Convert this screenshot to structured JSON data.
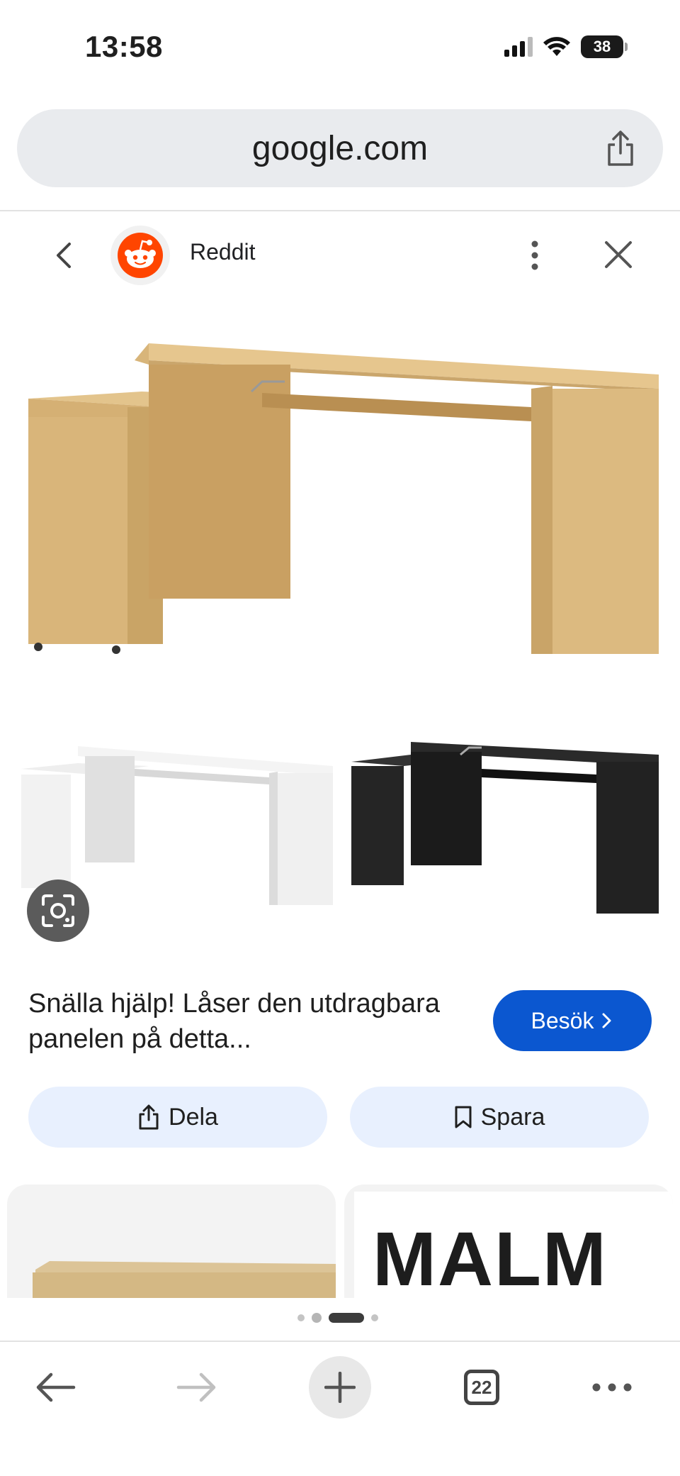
{
  "status_bar": {
    "time": "13:58",
    "battery": "38"
  },
  "url_bar": {
    "url": "google.com"
  },
  "source": {
    "name": "Reddit"
  },
  "result": {
    "title": "Snälla hjälp! Låser den utdragbara panelen på detta...",
    "visit_label": "Besök",
    "share_label": "Dela",
    "save_label": "Spara"
  },
  "related": {
    "right_text": "MALM"
  },
  "pager": {
    "count": 4,
    "active_index": 2
  },
  "toolbar": {
    "tab_count": "22"
  },
  "colors": {
    "accent": "#0b57d0",
    "pill_bg": "#e8f0fe",
    "url_bar_bg": "#e9ebee"
  }
}
